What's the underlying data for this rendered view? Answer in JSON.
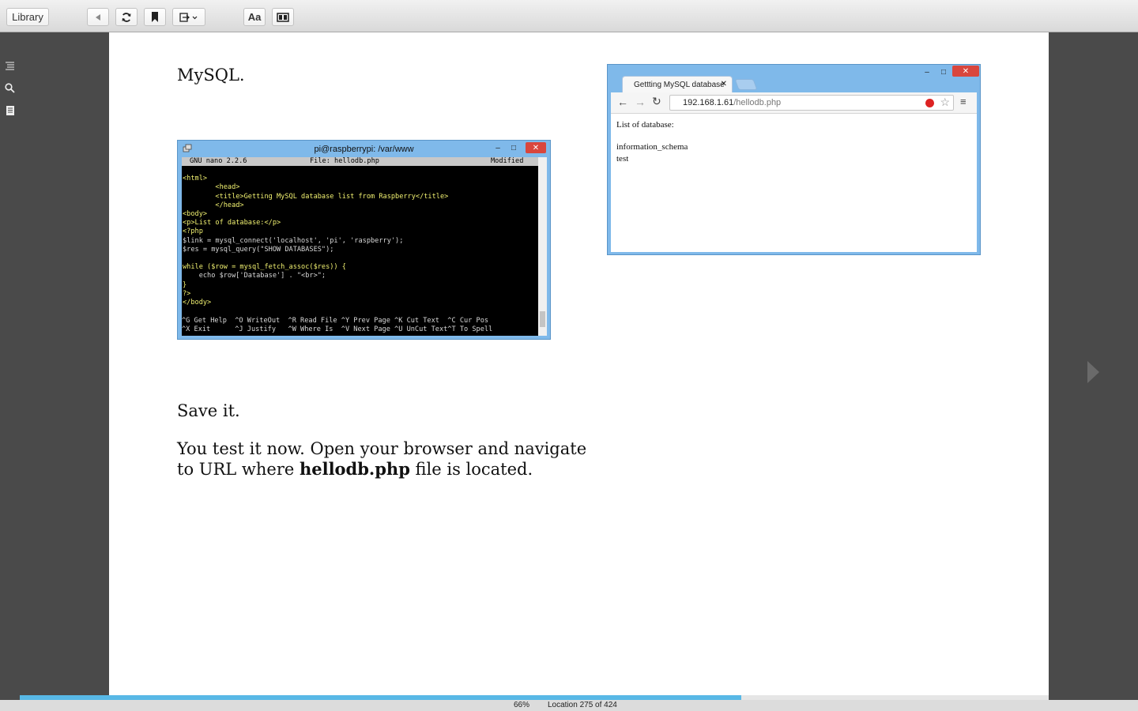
{
  "toolbar": {
    "library_label": "Library",
    "font_button_label": "Aa"
  },
  "page": {
    "heading_text": "MySQL.",
    "save_text": "Save it.",
    "para_part1": "You test it now. Open your browser and navigate",
    "para_part2": "to URL where ",
    "para_bold": "hellodb.php",
    "para_part3": " file is located."
  },
  "terminal": {
    "title": "pi@raspberrypi: /var/www",
    "nano_version": "GNU nano 2.2.6",
    "nano_file": "File: hellodb.php",
    "nano_status": "Modified",
    "code_lines": [
      "",
      "<html>",
      "        <head>",
      "        <title>Getting MySQL database list from Raspberry</title>",
      "        </head>",
      "<body>",
      "<p>List of database:</p>",
      "<?php",
      "$link = mysql_connect('localhost', 'pi', 'raspberry');",
      "$res = mysql_query(\"SHOW DATABASES\");",
      "",
      "while ($row = mysql_fetch_assoc($res)) {",
      "    echo $row['Database'] . \"<br>\";",
      "}",
      "?>",
      "</body>"
    ],
    "shortcuts_row1": "^G Get Help  ^O WriteOut  ^R Read File ^Y Prev Page ^K Cut Text  ^C Cur Pos",
    "shortcuts_row2": "^X Exit      ^J Justify   ^W Where Is  ^V Next Page ^U UnCut Text^T To Spell"
  },
  "browser": {
    "tab_title": "Gettting MySQL database",
    "url_host": "192.168.1.61",
    "url_path": "/hellodb.php",
    "content_heading": "List of database:",
    "db_items": [
      "information_schema",
      "test"
    ]
  },
  "status": {
    "percent": "66%",
    "location": "Location 275 of 424",
    "progress_fraction": 0.701
  },
  "colors": {
    "progress": "#58b8e6",
    "window_frame": "#7fb9ea",
    "close_button": "#d9463d",
    "cursor_green": "#10d010"
  }
}
